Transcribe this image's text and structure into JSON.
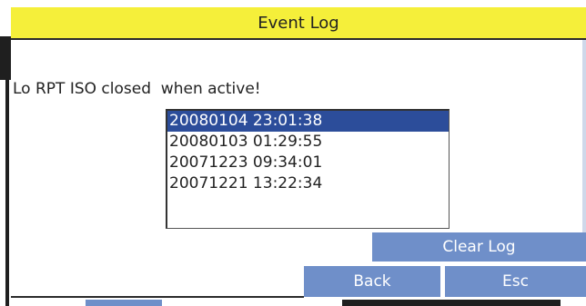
{
  "window": {
    "title": "Event Log"
  },
  "message": "Lo RPT ISO closed  when active!",
  "event_list": {
    "items": [
      "20080104 23:01:38",
      "20080103 01:29:55",
      "20071223 09:34:01",
      "20071221 13:22:34"
    ],
    "selected_index": 0
  },
  "buttons": {
    "clear_log": "Clear Log",
    "back": "Back",
    "esc": "Esc"
  },
  "colors": {
    "title_bar": "#f5ef3a",
    "button": "#6f8fc9",
    "selection": "#2c4d9a"
  }
}
